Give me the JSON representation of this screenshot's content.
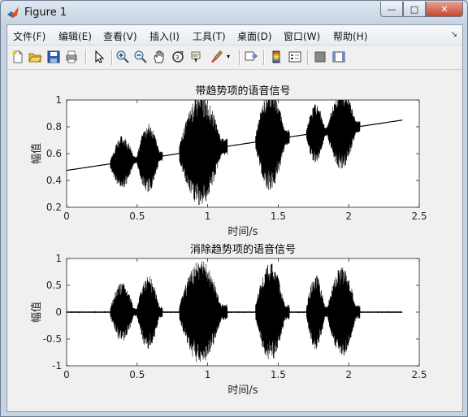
{
  "window": {
    "title": "Figure 1",
    "minimize": "—",
    "maximize": "□",
    "close": "✕"
  },
  "menu": [
    "文件(F)",
    "编辑(E)",
    "查看(V)",
    "插入(I)",
    "工具(T)",
    "桌面(D)",
    "窗口(W)",
    "帮助(H)"
  ],
  "menu_overflow": "↘",
  "toolbar": [
    "new-figure-icon",
    "open-icon",
    "save-icon",
    "print-icon",
    "pointer-icon",
    "zoom-in-icon",
    "zoom-out-icon",
    "pan-icon",
    "rotate-3d-icon",
    "data-cursor-icon",
    "brush-icon",
    "brush-dropdown-icon",
    "link-plot-icon",
    "colorbar-icon",
    "legend-icon",
    "hide-plot-tools-icon",
    "show-plot-tools-icon"
  ],
  "chart_data": [
    {
      "type": "line",
      "title": "带趋势项的语音信号",
      "xlabel": "时间/s",
      "ylabel": "幅值",
      "xlim": [
        0,
        2.5
      ],
      "ylim": [
        0.2,
        1
      ],
      "xticks": [
        "0",
        "0.5",
        "1",
        "1.5",
        "2",
        "2.5"
      ],
      "yticks": [
        "0.2",
        "0.4",
        "0.6",
        "0.8",
        "1"
      ],
      "trend": {
        "x": [
          0,
          2.38
        ],
        "y": [
          0.475,
          0.85
        ]
      },
      "segments": [
        {
          "start": 0.31,
          "end": 0.5,
          "amplitude": 0.2
        },
        {
          "start": 0.5,
          "end": 0.68,
          "amplitude": 0.26
        },
        {
          "start": 0.8,
          "end": 1.14,
          "amplitude": 0.42
        },
        {
          "start": 1.34,
          "end": 1.58,
          "amplitude": 0.38
        },
        {
          "start": 1.7,
          "end": 1.85,
          "amplitude": 0.22
        },
        {
          "start": 1.85,
          "end": 2.08,
          "amplitude": 0.3
        }
      ],
      "color": "#000000"
    },
    {
      "type": "line",
      "title": "消除趋势项的语音信号",
      "xlabel": "时间/s",
      "ylabel": "幅值",
      "xlim": [
        0,
        2.5
      ],
      "ylim": [
        -1,
        1
      ],
      "xticks": [
        "0",
        "0.5",
        "1",
        "1.5",
        "2",
        "2.5"
      ],
      "yticks": [
        "-1",
        "-0.5",
        "0",
        "0.5",
        "1"
      ],
      "trend": {
        "x": [
          0,
          2.38
        ],
        "y": [
          0,
          0
        ]
      },
      "segments": [
        {
          "start": 0.31,
          "end": 0.5,
          "amplitude": 0.55
        },
        {
          "start": 0.5,
          "end": 0.68,
          "amplitude": 0.7
        },
        {
          "start": 0.8,
          "end": 1.14,
          "amplitude": 0.97
        },
        {
          "start": 1.34,
          "end": 1.58,
          "amplitude": 0.92
        },
        {
          "start": 1.7,
          "end": 1.85,
          "amplitude": 0.7
        },
        {
          "start": 1.85,
          "end": 2.08,
          "amplitude": 0.85
        }
      ],
      "color": "#000000"
    }
  ]
}
